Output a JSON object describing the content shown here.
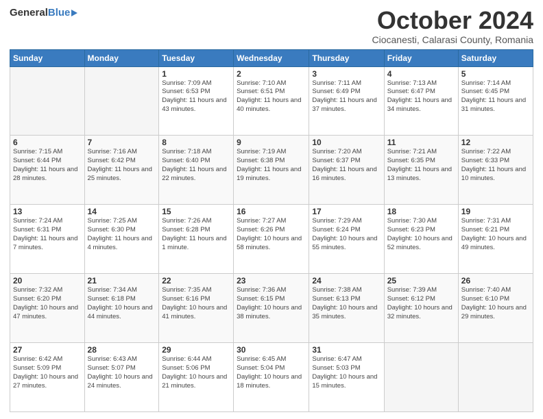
{
  "header": {
    "logo_general": "General",
    "logo_blue": "Blue",
    "month_title": "October 2024",
    "location": "Ciocanesti, Calarasi County, Romania"
  },
  "weekdays": [
    "Sunday",
    "Monday",
    "Tuesday",
    "Wednesday",
    "Thursday",
    "Friday",
    "Saturday"
  ],
  "weeks": [
    [
      {
        "day": "",
        "info": ""
      },
      {
        "day": "",
        "info": ""
      },
      {
        "day": "1",
        "info": "Sunrise: 7:09 AM\nSunset: 6:53 PM\nDaylight: 11 hours and 43 minutes."
      },
      {
        "day": "2",
        "info": "Sunrise: 7:10 AM\nSunset: 6:51 PM\nDaylight: 11 hours and 40 minutes."
      },
      {
        "day": "3",
        "info": "Sunrise: 7:11 AM\nSunset: 6:49 PM\nDaylight: 11 hours and 37 minutes."
      },
      {
        "day": "4",
        "info": "Sunrise: 7:13 AM\nSunset: 6:47 PM\nDaylight: 11 hours and 34 minutes."
      },
      {
        "day": "5",
        "info": "Sunrise: 7:14 AM\nSunset: 6:45 PM\nDaylight: 11 hours and 31 minutes."
      }
    ],
    [
      {
        "day": "6",
        "info": "Sunrise: 7:15 AM\nSunset: 6:44 PM\nDaylight: 11 hours and 28 minutes."
      },
      {
        "day": "7",
        "info": "Sunrise: 7:16 AM\nSunset: 6:42 PM\nDaylight: 11 hours and 25 minutes."
      },
      {
        "day": "8",
        "info": "Sunrise: 7:18 AM\nSunset: 6:40 PM\nDaylight: 11 hours and 22 minutes."
      },
      {
        "day": "9",
        "info": "Sunrise: 7:19 AM\nSunset: 6:38 PM\nDaylight: 11 hours and 19 minutes."
      },
      {
        "day": "10",
        "info": "Sunrise: 7:20 AM\nSunset: 6:37 PM\nDaylight: 11 hours and 16 minutes."
      },
      {
        "day": "11",
        "info": "Sunrise: 7:21 AM\nSunset: 6:35 PM\nDaylight: 11 hours and 13 minutes."
      },
      {
        "day": "12",
        "info": "Sunrise: 7:22 AM\nSunset: 6:33 PM\nDaylight: 11 hours and 10 minutes."
      }
    ],
    [
      {
        "day": "13",
        "info": "Sunrise: 7:24 AM\nSunset: 6:31 PM\nDaylight: 11 hours and 7 minutes."
      },
      {
        "day": "14",
        "info": "Sunrise: 7:25 AM\nSunset: 6:30 PM\nDaylight: 11 hours and 4 minutes."
      },
      {
        "day": "15",
        "info": "Sunrise: 7:26 AM\nSunset: 6:28 PM\nDaylight: 11 hours and 1 minute."
      },
      {
        "day": "16",
        "info": "Sunrise: 7:27 AM\nSunset: 6:26 PM\nDaylight: 10 hours and 58 minutes."
      },
      {
        "day": "17",
        "info": "Sunrise: 7:29 AM\nSunset: 6:24 PM\nDaylight: 10 hours and 55 minutes."
      },
      {
        "day": "18",
        "info": "Sunrise: 7:30 AM\nSunset: 6:23 PM\nDaylight: 10 hours and 52 minutes."
      },
      {
        "day": "19",
        "info": "Sunrise: 7:31 AM\nSunset: 6:21 PM\nDaylight: 10 hours and 49 minutes."
      }
    ],
    [
      {
        "day": "20",
        "info": "Sunrise: 7:32 AM\nSunset: 6:20 PM\nDaylight: 10 hours and 47 minutes."
      },
      {
        "day": "21",
        "info": "Sunrise: 7:34 AM\nSunset: 6:18 PM\nDaylight: 10 hours and 44 minutes."
      },
      {
        "day": "22",
        "info": "Sunrise: 7:35 AM\nSunset: 6:16 PM\nDaylight: 10 hours and 41 minutes."
      },
      {
        "day": "23",
        "info": "Sunrise: 7:36 AM\nSunset: 6:15 PM\nDaylight: 10 hours and 38 minutes."
      },
      {
        "day": "24",
        "info": "Sunrise: 7:38 AM\nSunset: 6:13 PM\nDaylight: 10 hours and 35 minutes."
      },
      {
        "day": "25",
        "info": "Sunrise: 7:39 AM\nSunset: 6:12 PM\nDaylight: 10 hours and 32 minutes."
      },
      {
        "day": "26",
        "info": "Sunrise: 7:40 AM\nSunset: 6:10 PM\nDaylight: 10 hours and 29 minutes."
      }
    ],
    [
      {
        "day": "27",
        "info": "Sunrise: 6:42 AM\nSunset: 5:09 PM\nDaylight: 10 hours and 27 minutes."
      },
      {
        "day": "28",
        "info": "Sunrise: 6:43 AM\nSunset: 5:07 PM\nDaylight: 10 hours and 24 minutes."
      },
      {
        "day": "29",
        "info": "Sunrise: 6:44 AM\nSunset: 5:06 PM\nDaylight: 10 hours and 21 minutes."
      },
      {
        "day": "30",
        "info": "Sunrise: 6:45 AM\nSunset: 5:04 PM\nDaylight: 10 hours and 18 minutes."
      },
      {
        "day": "31",
        "info": "Sunrise: 6:47 AM\nSunset: 5:03 PM\nDaylight: 10 hours and 15 minutes."
      },
      {
        "day": "",
        "info": ""
      },
      {
        "day": "",
        "info": ""
      }
    ]
  ]
}
